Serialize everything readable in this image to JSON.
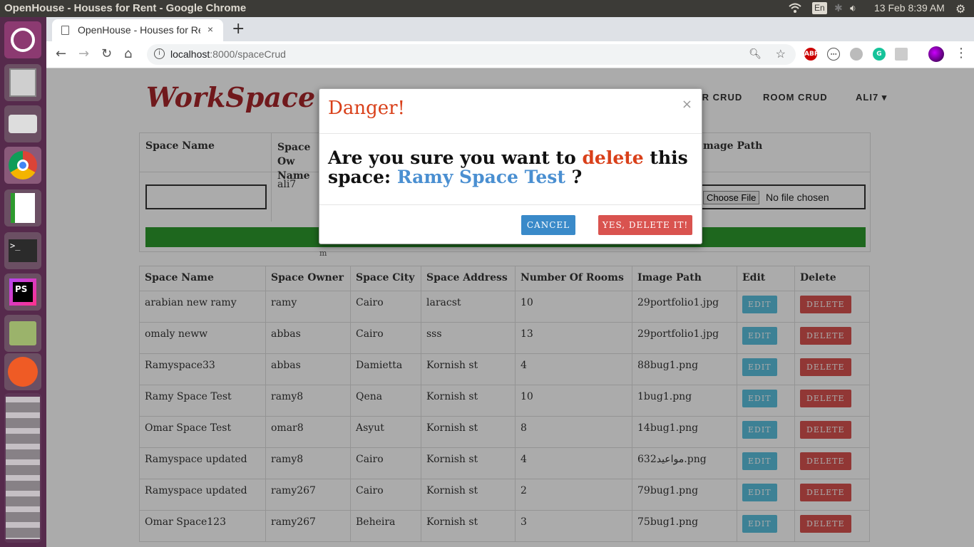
{
  "os": {
    "window_title": "OpenHouse - Houses for Rent - Google Chrome",
    "keyboard_layout": "En",
    "datetime": "13 Feb  8:39 AM"
  },
  "browser": {
    "tab_title": "OpenHouse - Houses for Rent",
    "tab_close": "×",
    "new_tab": "+",
    "url_host": "localhost",
    "url_path": ":8000/spaceCrud"
  },
  "site": {
    "brand": "WorkSpace",
    "nav": [
      "ER CRUD",
      "ROOM CRUD",
      "ALI7 ▾"
    ]
  },
  "form": {
    "headers": [
      "Space Name",
      "Space Ow Name",
      "mage Path"
    ],
    "owner_value": "ali7",
    "file_button": "Choose File",
    "file_status": "No file chosen",
    "stray_text": "m"
  },
  "table": {
    "headers": [
      "Space Name",
      "Space Owner",
      "Space City",
      "Space Address",
      "Number Of Rooms",
      "Image Path",
      "Edit",
      "Delete"
    ],
    "edit_label": "EDIT",
    "delete_label": "DELETE",
    "rows": [
      [
        "arabian new ramy",
        "ramy",
        "Cairo",
        "laracst",
        "10",
        "29portfolio1.jpg"
      ],
      [
        "omaly neww",
        "abbas",
        "Cairo",
        "sss",
        "13",
        "29portfolio1.jpg"
      ],
      [
        "Ramyspace33",
        "abbas",
        "Damietta",
        "Kornish st",
        "4",
        "88bug1.png"
      ],
      [
        "Ramy Space Test",
        "ramy8",
        "Qena",
        "Kornish st",
        "10",
        "1bug1.png"
      ],
      [
        "Omar Space Test",
        "omar8",
        "Asyut",
        "Kornish st",
        "8",
        "14bug1.png"
      ],
      [
        "Ramyspace updated",
        "ramy8",
        "Cairo",
        "Kornish st",
        "4",
        "632مواعيد.png"
      ],
      [
        "Ramyspace updated",
        "ramy267",
        "Cairo",
        "Kornish st",
        "2",
        "79bug1.png"
      ],
      [
        "Omar Space123",
        "ramy267",
        "Beheira",
        "Kornish st",
        "3",
        "75bug1.png"
      ]
    ]
  },
  "modal": {
    "title": "Danger!",
    "close": "×",
    "msg_part1": "Are you sure you want to ",
    "msg_red": "delete",
    "msg_part2": " this space: ",
    "msg_name": "Ramy Space Test",
    "msg_end": " ?",
    "cancel_label": "CANCEL",
    "confirm_label": "YES, DELETE IT!"
  },
  "colors": {
    "danger": "#d9401a",
    "accent_blue": "#4a8fd1",
    "launcher_bg": "#562a4c"
  }
}
